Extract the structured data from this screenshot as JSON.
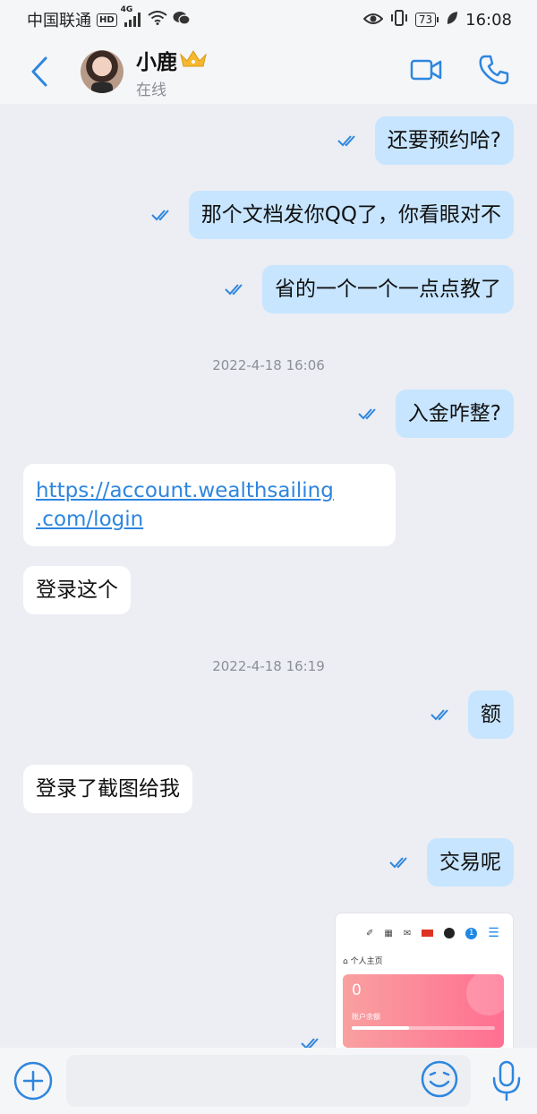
{
  "status_bar": {
    "carrier": "中国联通",
    "hd": "HD",
    "network": "4G",
    "battery": "73",
    "time": "16:08"
  },
  "header": {
    "contact_name": "小鹿",
    "presence": "在线"
  },
  "timestamps": [
    "2022-4-18 16:06",
    "2022-4-18 16:19"
  ],
  "messages": [
    {
      "side": "out",
      "text": "还要预约哈?"
    },
    {
      "side": "out",
      "text": "那个文档发你QQ了，你看眼对不"
    },
    {
      "side": "out",
      "text": "省的一个一个一点点教了"
    },
    {
      "side": "out",
      "text": "入金咋整?"
    },
    {
      "side": "in",
      "link": [
        "https://account.wealthsailing",
        ".com/login"
      ]
    },
    {
      "side": "in",
      "text": "登录这个"
    },
    {
      "side": "out",
      "text": "额"
    },
    {
      "side": "in",
      "text": "登录了截图给我"
    },
    {
      "side": "out",
      "text": "交易呢"
    }
  ],
  "screenshot_message": {
    "breadcrumb": "个人主页",
    "balance": "0",
    "balance_label": "账户余额",
    "notification_count": "1",
    "progress": 0.4
  },
  "colors": {
    "outgoing_bubble": "#c7e5ff",
    "incoming_bubble": "#ffffff",
    "accent": "#2e86de"
  },
  "icons": [
    "back-arrow-icon",
    "video-call-icon",
    "phone-icon",
    "crown-icon",
    "double-check-icon",
    "plus-icon",
    "emoji-icon",
    "microphone-icon"
  ]
}
